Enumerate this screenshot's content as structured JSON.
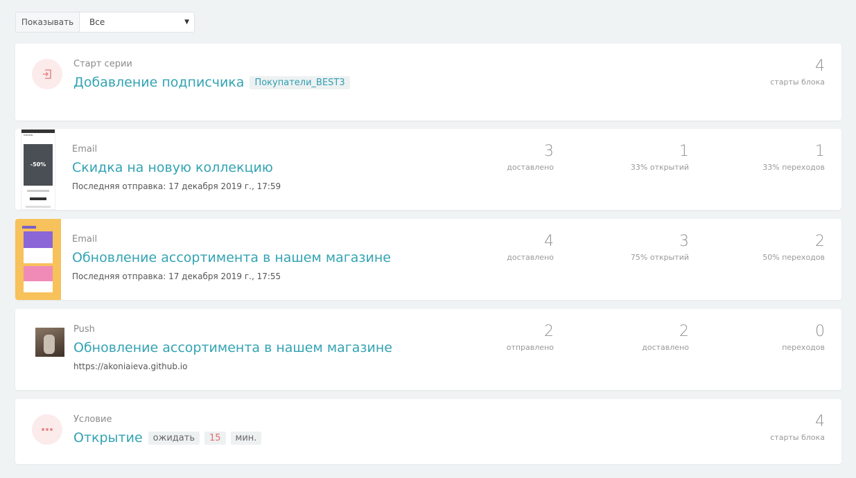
{
  "filter": {
    "label": "Показывать",
    "selected": "Все"
  },
  "start": {
    "type": "Старт серии",
    "title": "Добавление подписчика",
    "tag": "Покупатели_BEST3",
    "stat": {
      "value": "4",
      "label": "старты блока"
    }
  },
  "email1": {
    "type": "Email",
    "title": "Скидка на новую коллекцию",
    "meta": "Последняя отправка: 17 декабря 2019 г., 17:59",
    "thumb_text": "-50%",
    "stats": [
      {
        "value": "3",
        "label": "доставлено"
      },
      {
        "value": "1",
        "label": "33% открытий"
      },
      {
        "value": "1",
        "label": "33% переходов"
      }
    ]
  },
  "email2": {
    "type": "Email",
    "title": "Обновление ассортимента в нашем магазине",
    "meta": "Последняя отправка: 17 декабря 2019 г., 17:55",
    "stats": [
      {
        "value": "4",
        "label": "доставлено"
      },
      {
        "value": "3",
        "label": "75% открытий"
      },
      {
        "value": "2",
        "label": "50% переходов"
      }
    ]
  },
  "push": {
    "type": "Push",
    "title": "Обновление ассортимента в нашем магазине",
    "meta": "https://akoniaieva.github.io",
    "stats": [
      {
        "value": "2",
        "label": "отправлено"
      },
      {
        "value": "2",
        "label": "доставлено"
      },
      {
        "value": "0",
        "label": "переходов"
      }
    ]
  },
  "condition": {
    "type": "Условие",
    "title": "Открытие",
    "wait_label": "ожидать",
    "wait_value": "15",
    "wait_unit": "мин.",
    "stat": {
      "value": "4",
      "label": "старты блока"
    }
  },
  "colors": {
    "accent": "#33a3b3",
    "icon_bg": "#fcebeb",
    "icon": "#e58b8b",
    "background": "#f0f3f4"
  },
  "icons": {
    "start": "enter-icon",
    "condition": "dots-icon",
    "select": "caret-down-icon"
  }
}
